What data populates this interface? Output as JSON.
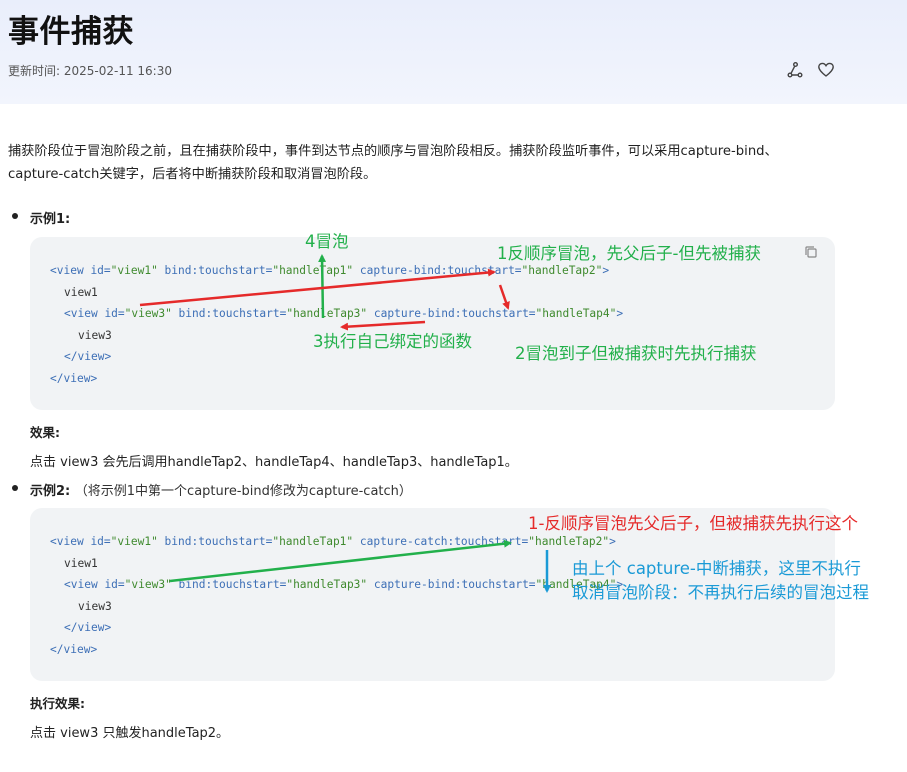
{
  "page": {
    "title": "事件捕获",
    "updated": "更新时间: 2025-02-11 16:30"
  },
  "intro": "捕获阶段位于冒泡阶段之前，且在捕获阶段中，事件到达节点的顺序与冒泡阶段相反。捕获阶段监听事件，可以采用capture-bind、capture-catch关键字，后者将中断捕获阶段和取消冒泡阶段。",
  "example1": {
    "title": "示例1:",
    "code": {
      "l1": {
        "t1": "<",
        "t2": "view",
        "t3": " id=",
        "t4": "\"view1\"",
        "t5": " bind:touchstart=",
        "t6": "\"handleTap1\"",
        "t7": " capture-bind:touchstart=",
        "t8": "\"handleTap2\"",
        "t9": ">"
      },
      "l2": "view1",
      "l3": {
        "t1": "<",
        "t2": "view",
        "t3": " id=",
        "t4": "\"view3\"",
        "t5": " bind:touchstart=",
        "t6": "\"handleTap3\"",
        "t7": " capture-bind:touchstart=",
        "t8": "\"handleTap4\"",
        "t9": ">"
      },
      "l4": "view3",
      "l5": {
        "t1": "</",
        "t2": "view",
        "t3": ">"
      },
      "l6": {
        "t1": "</",
        "t2": "view",
        "t3": ">"
      }
    },
    "result_heading": "效果:",
    "result_text": "点击 view3 会先后调用handleTap2、handleTap4、handleTap3、handleTap1。"
  },
  "example2": {
    "title": "示例2:",
    "note": "（将示例1中第一个capture-bind修改为capture-catch）",
    "code": {
      "l1": {
        "t1": "<",
        "t2": "view",
        "t3": " id=",
        "t4": "\"view1\"",
        "t5": " bind:touchstart=",
        "t6": "\"handleTap1\"",
        "t7": " capture-catch:touchstart=",
        "t8": "\"handleTap2\"",
        "t9": ">"
      },
      "l2": "view1",
      "l3": {
        "t1": "<",
        "t2": "view",
        "t3": " id=",
        "t4": "\"view3\"",
        "t5": " bind:touchstart=",
        "t6": "\"handleTap3\"",
        "t7": " capture-bind:touchstart=",
        "t8": "\"handleTap4\"",
        "t9": ">"
      },
      "l4": "view3",
      "l5": {
        "t1": "</",
        "t2": "view",
        "t3": ">"
      },
      "l6": {
        "t1": "</",
        "t2": "view",
        "t3": ">"
      }
    },
    "result_heading": "执行效果:",
    "result_text": "点击 view3 只触发handleTap2。"
  },
  "annotations": {
    "a1": "4冒泡",
    "a2": "1反顺序冒泡，先父后子-但先被捕获",
    "a3": "3执行自己绑定的函数",
    "a4": "2冒泡到子但被捕获时先执行捕获",
    "a5": "1-反顺序冒泡先父后子，但被捕获先执行这个",
    "a6": "由上个 capture-中断捕获，这里不执行",
    "a7": "取消冒泡阶段：不再执行后续的冒泡过程"
  },
  "colors": {
    "green": "#22b04b",
    "red": "#e52a2a",
    "blue": "#1a9ad6",
    "code_bg": "#f1f3f5"
  },
  "icons": [
    "share-icon",
    "heart-icon",
    "copy-icon"
  ]
}
